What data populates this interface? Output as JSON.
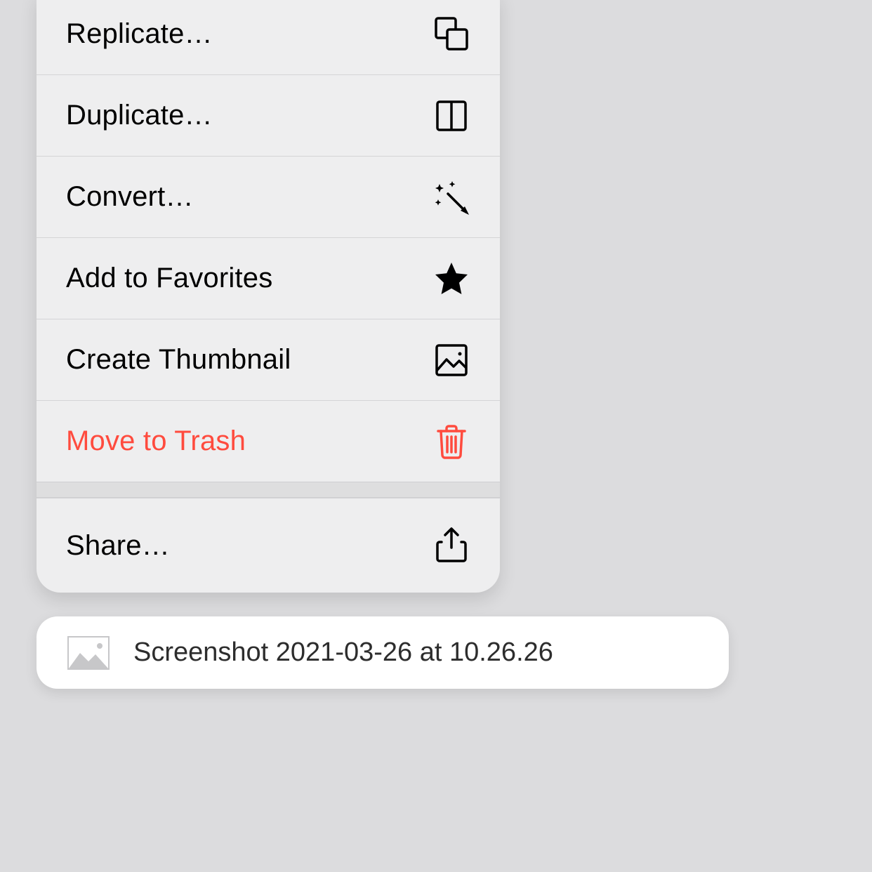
{
  "menu": {
    "items": [
      {
        "label": "Replicate…",
        "icon": "replicate-icon",
        "destructive": false
      },
      {
        "label": "Duplicate…",
        "icon": "duplicate-icon",
        "destructive": false
      },
      {
        "label": "Convert…",
        "icon": "convert-icon",
        "destructive": false
      },
      {
        "label": "Add to Favorites",
        "icon": "star-icon",
        "destructive": false
      },
      {
        "label": "Create Thumbnail",
        "icon": "create-thumbnail-icon",
        "destructive": false
      },
      {
        "label": "Move to Trash",
        "icon": "trash-icon",
        "destructive": true
      }
    ],
    "share": {
      "label": "Share…",
      "icon": "share-icon"
    }
  },
  "file": {
    "name": "Screenshot 2021-03-26 at 10.26.26",
    "icon": "image-thumb-icon"
  },
  "colors": {
    "destructive": "#ff4b3e",
    "text": "#000000",
    "menu_bg": "#eeeeef",
    "page_bg": "#dcdcde"
  }
}
